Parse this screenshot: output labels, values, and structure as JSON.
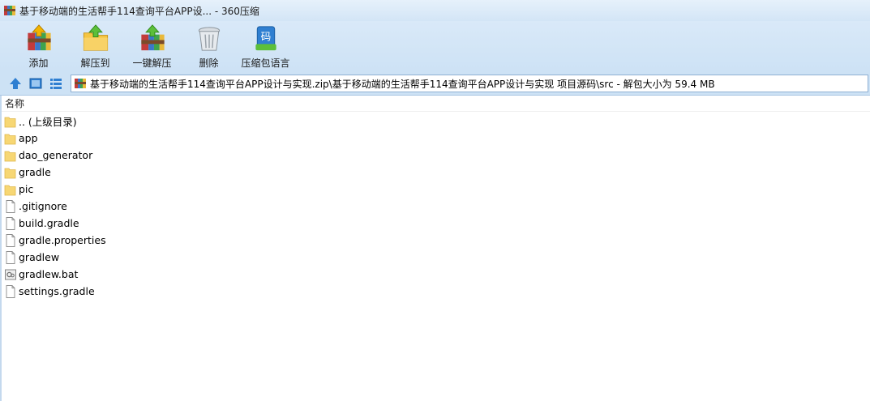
{
  "window": {
    "title": "基于移动端的生活帮手114查询平台APP设... - 360压缩"
  },
  "toolbar": {
    "items": [
      {
        "label": "添加",
        "icon": "add-archive-icon"
      },
      {
        "label": "解压到",
        "icon": "extract-to-icon"
      },
      {
        "label": "一键解压",
        "icon": "one-click-extract-icon"
      },
      {
        "label": "删除",
        "icon": "delete-trash-icon"
      },
      {
        "label": "压缩包语言",
        "icon": "archive-language-icon"
      }
    ]
  },
  "address": {
    "path": "基于移动端的生活帮手114查询平台APP设计与实现.zip\\基于移动端的生活帮手114查询平台APP设计与实现 项目源码\\src - 解包大小为 59.4 MB"
  },
  "list": {
    "column_name": "名称",
    "rows": [
      {
        "name": ".. (上级目录)",
        "type": "folder"
      },
      {
        "name": "app",
        "type": "folder"
      },
      {
        "name": "dao_generator",
        "type": "folder"
      },
      {
        "name": "gradle",
        "type": "folder"
      },
      {
        "name": "pic",
        "type": "folder"
      },
      {
        "name": ".gitignore",
        "type": "file"
      },
      {
        "name": "build.gradle",
        "type": "file"
      },
      {
        "name": "gradle.properties",
        "type": "file"
      },
      {
        "name": "gradlew",
        "type": "file"
      },
      {
        "name": "gradlew.bat",
        "type": "bat"
      },
      {
        "name": "settings.gradle",
        "type": "file"
      }
    ]
  },
  "colors": {
    "toolbar_bg": "#cde2f5",
    "folder": "#f7d774",
    "accent": "#2f7fd1"
  }
}
